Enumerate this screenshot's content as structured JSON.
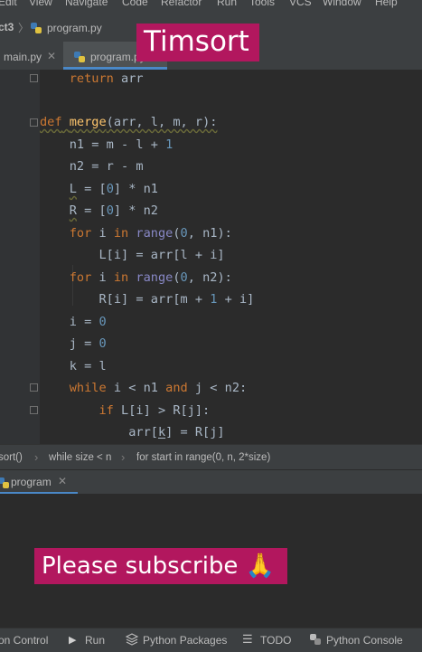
{
  "menu": {
    "items": [
      "Edit",
      "View",
      "Navigate",
      "Code",
      "Refactor",
      "Run",
      "Tools",
      "VCS",
      "Window",
      "Help"
    ]
  },
  "navbar": {
    "project": "ct3",
    "file": "program.py"
  },
  "tabs": [
    {
      "label": "main.py",
      "active": false
    },
    {
      "label": "program.py",
      "active": true
    }
  ],
  "overlay": {
    "title": "Timsort",
    "subscribe": "Please subscribe 🙏"
  },
  "code": {
    "lines": [
      "    return arr",
      "",
      "def merge(arr, l, m, r):",
      "    n1 = m - l + 1",
      "    n2 = r - m",
      "    L = [0] * n1",
      "    R = [0] * n2",
      "    for i in range(0, n1):",
      "        L[i] = arr[l + i]",
      "    for i in range(0, n2):",
      "        R[i] = arr[m + 1 + i]",
      "    i = 0",
      "    j = 0",
      "    k = l",
      "    while i < n1 and j < n2:",
      "        if L[i] > R[j]:",
      "            arr[k] = R[j]"
    ]
  },
  "breadcrumbs": [
    "sort()",
    "while size < n",
    "for start in range(0, n, 2*size)"
  ],
  "run_panel": {
    "tab_label": "program"
  },
  "bottom_toolbar": [
    "on Control",
    "Run",
    "Python Packages",
    "TODO",
    "Python Console"
  ],
  "colors": {
    "overlay": "#b2175e",
    "keyword": "#cc7832",
    "number": "#6897bb",
    "function": "#ffc66d",
    "builtin": "#8888c6"
  }
}
